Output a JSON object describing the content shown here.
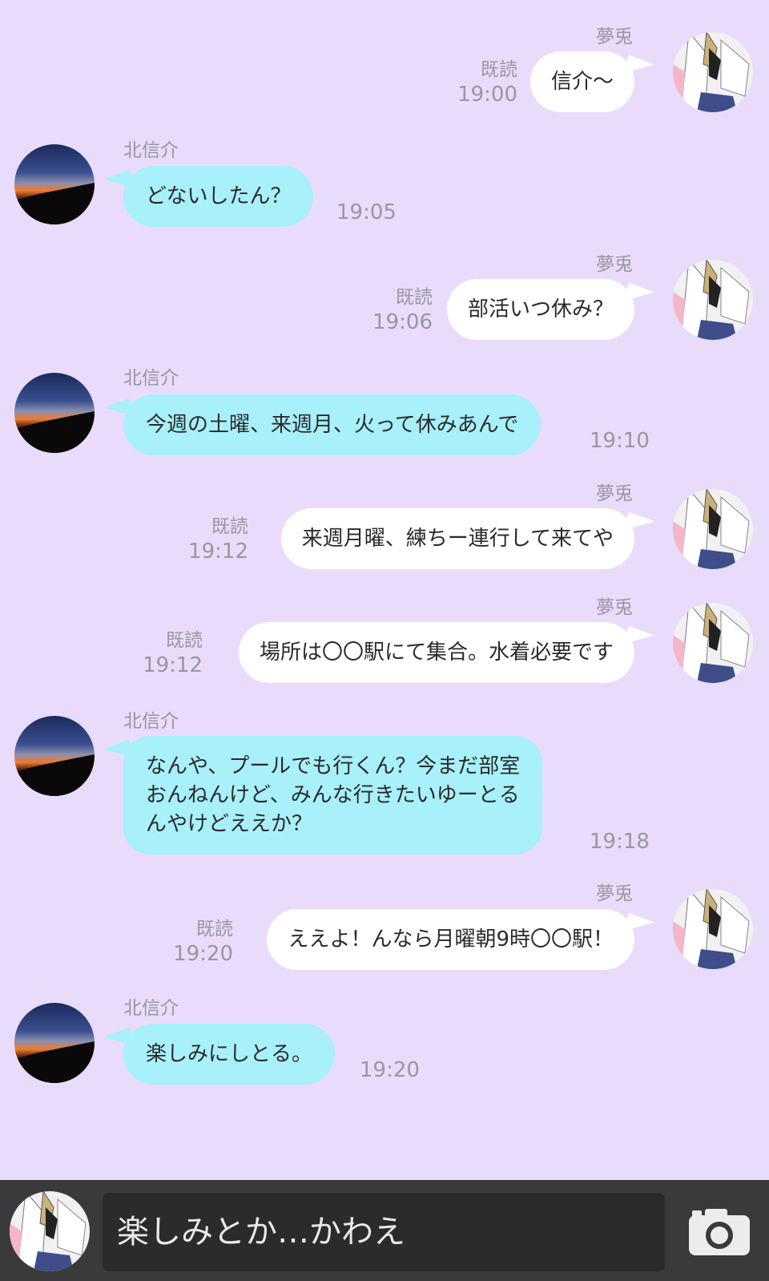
{
  "contacts": {
    "self_name": "夢兎",
    "other_name": "北信介"
  },
  "messages": [
    {
      "side": "right",
      "text": "信介〜",
      "read": "既読",
      "time": "19:00"
    },
    {
      "side": "left",
      "text": "どないしたん？",
      "time": "19:05"
    },
    {
      "side": "right",
      "text": "部活いつ休み？",
      "read": "既読",
      "time": "19:06"
    },
    {
      "side": "left",
      "text": "今週の土曜、来週月、火って休みあんで",
      "time": "19:10"
    },
    {
      "side": "right",
      "text": "来週月曜、練ちー連行して来てや",
      "read": "既読",
      "time": "19:12"
    },
    {
      "side": "right",
      "text": "場所は〇〇駅にて集合。水着必要です",
      "read": "既読",
      "time": "19:12"
    },
    {
      "side": "left",
      "text": "なんや、プールでも行くん？今まだ部室\nおんねんけど、みんな行きたいゆーとる\nんやけどええか？",
      "time": "19:18"
    },
    {
      "side": "right",
      "text": "ええよ！んなら月曜朝9時〇〇駅！",
      "read": "既読",
      "time": "19:20"
    },
    {
      "side": "left",
      "text": "楽しみにしとる。",
      "time": "19:20"
    }
  ],
  "input": {
    "value": "楽しみとか…かわえ",
    "camera_icon": "camera-icon"
  },
  "colors": {
    "background": "#e9dcfb",
    "left_bubble": "#a8f0fa",
    "right_bubble": "#ffffff",
    "meta_text": "#9a95a3",
    "input_bar": "#3a3a3c"
  }
}
